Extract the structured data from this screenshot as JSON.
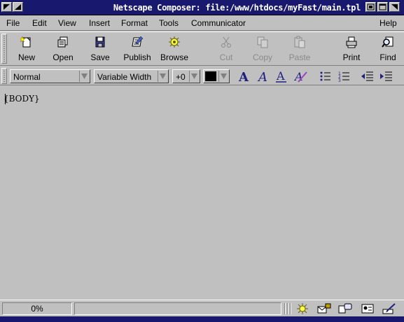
{
  "window": {
    "title": "Netscape Composer: file:/www/htdocs/myFast/main.tpl"
  },
  "menubar": {
    "items": [
      "File",
      "Edit",
      "View",
      "Insert",
      "Format",
      "Tools",
      "Communicator",
      "Help"
    ]
  },
  "toolbar": {
    "buttons": [
      {
        "label": "New",
        "icon": "new-page-icon",
        "enabled": true
      },
      {
        "label": "Open",
        "icon": "open-icon",
        "enabled": true
      },
      {
        "label": "Save",
        "icon": "save-disk-icon",
        "enabled": true
      },
      {
        "label": "Publish",
        "icon": "publish-icon",
        "enabled": true
      },
      {
        "label": "Browse",
        "icon": "browse-icon",
        "enabled": true
      },
      {
        "label": "Cut",
        "icon": "scissors-icon",
        "enabled": false
      },
      {
        "label": "Copy",
        "icon": "copy-icon",
        "enabled": false
      },
      {
        "label": "Paste",
        "icon": "paste-icon",
        "enabled": false
      },
      {
        "label": "Print",
        "icon": "printer-icon",
        "enabled": true
      },
      {
        "label": "Find",
        "icon": "find-icon",
        "enabled": true
      }
    ]
  },
  "formatbar": {
    "paragraph_style": "Normal",
    "font_face": "Variable Width",
    "font_size": "+0",
    "text_color": "#000000"
  },
  "document": {
    "content": "{BODY}"
  },
  "statusbar": {
    "progress": "0%",
    "message": ""
  },
  "colors": {
    "chrome": "#c0c0c0",
    "titlebar": "#18186e"
  }
}
